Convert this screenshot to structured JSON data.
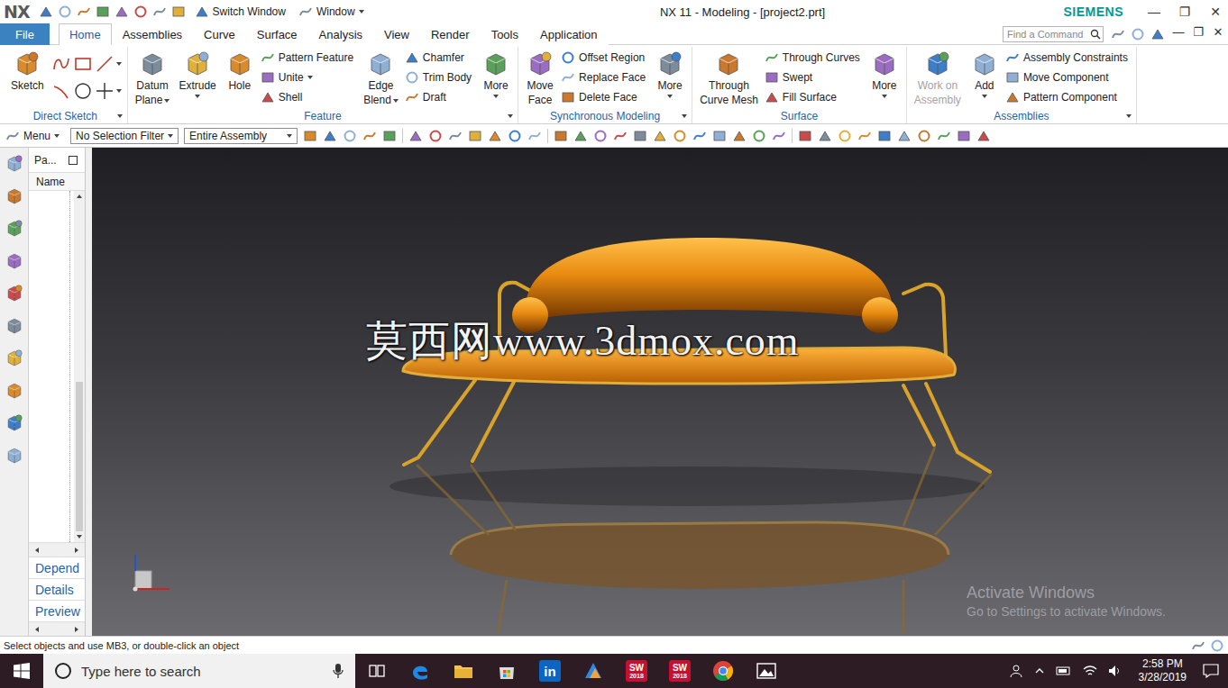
{
  "title_bar": {
    "logo": "NX",
    "switch_window": "Switch Window",
    "window_menu": "Window",
    "title": "NX 11 - Modeling - [project2.prt]",
    "brand": "SIEMENS",
    "controls": [
      "—",
      "❐",
      "✕"
    ]
  },
  "menu_tabs": [
    {
      "label": "File",
      "selected": false,
      "kind": "file"
    },
    {
      "label": "Home",
      "selected": true,
      "kind": "tab"
    },
    {
      "label": "Assemblies",
      "selected": false,
      "kind": "tab"
    },
    {
      "label": "Curve",
      "selected": false,
      "kind": "tab"
    },
    {
      "label": "Surface",
      "selected": false,
      "kind": "tab"
    },
    {
      "label": "Analysis",
      "selected": false,
      "kind": "tab"
    },
    {
      "label": "View",
      "selected": false,
      "kind": "tab"
    },
    {
      "label": "Render",
      "selected": false,
      "kind": "tab"
    },
    {
      "label": "Tools",
      "selected": false,
      "kind": "tab"
    },
    {
      "label": "Application",
      "selected": false,
      "kind": "tab"
    }
  ],
  "command_search": {
    "placeholder": "Find a Command"
  },
  "inner_controls": [
    "—",
    "❐",
    "✕"
  ],
  "ribbon_groups": [
    {
      "title": "Direct Sketch",
      "expandable": true,
      "items": [
        {
          "kind": "large",
          "lines": [
            "Sketch"
          ],
          "dropdown": false,
          "disabled": false
        },
        {
          "kind": "sketch_tools"
        }
      ]
    },
    {
      "title": "Feature",
      "expandable": true,
      "items": [
        {
          "kind": "large",
          "lines": [
            "Datum",
            "Plane"
          ],
          "dropdown": true,
          "disabled": false
        },
        {
          "kind": "large",
          "lines": [
            "Extrude"
          ],
          "dropdown": true,
          "disabled": false
        },
        {
          "kind": "large",
          "lines": [
            "Hole"
          ],
          "dropdown": false,
          "disabled": false
        },
        {
          "kind": "column",
          "items": [
            {
              "label": "Pattern Feature",
              "dropdown": false
            },
            {
              "label": "Unite",
              "dropdown": true
            },
            {
              "label": "Shell",
              "dropdown": false
            }
          ]
        },
        {
          "kind": "large",
          "lines": [
            "Edge",
            "Blend"
          ],
          "dropdown": true,
          "disabled": false
        },
        {
          "kind": "column",
          "items": [
            {
              "label": "Chamfer",
              "dropdown": false
            },
            {
              "label": "Trim Body",
              "dropdown": false
            },
            {
              "label": "Draft",
              "dropdown": false
            }
          ]
        },
        {
          "kind": "large",
          "lines": [
            "More"
          ],
          "dropdown": true,
          "disabled": false
        }
      ]
    },
    {
      "title": "Synchronous Modeling",
      "expandable": true,
      "items": [
        {
          "kind": "large",
          "lines": [
            "Move",
            "Face"
          ],
          "dropdown": false,
          "disabled": false
        },
        {
          "kind": "column",
          "items": [
            {
              "label": "Offset Region",
              "dropdown": false
            },
            {
              "label": "Replace Face",
              "dropdown": false
            },
            {
              "label": "Delete Face",
              "dropdown": false
            }
          ]
        },
        {
          "kind": "large",
          "lines": [
            "More"
          ],
          "dropdown": true,
          "disabled": false
        }
      ]
    },
    {
      "title": "Surface",
      "expandable": false,
      "items": [
        {
          "kind": "large",
          "lines": [
            "Through",
            "Curve Mesh"
          ],
          "dropdown": false,
          "disabled": false
        },
        {
          "kind": "column",
          "items": [
            {
              "label": "Through Curves",
              "dropdown": false
            },
            {
              "label": "Swept",
              "dropdown": false
            },
            {
              "label": "Fill Surface",
              "dropdown": false
            }
          ]
        },
        {
          "kind": "large",
          "lines": [
            "More"
          ],
          "dropdown": true,
          "disabled": false
        }
      ]
    },
    {
      "title": "Assemblies",
      "expandable": true,
      "items": [
        {
          "kind": "large",
          "lines": [
            "Work on",
            "Assembly"
          ],
          "dropdown": false,
          "disabled": true
        },
        {
          "kind": "large",
          "lines": [
            "Add"
          ],
          "dropdown": true,
          "disabled": false
        },
        {
          "kind": "column",
          "items": [
            {
              "label": "Assembly Constraints",
              "dropdown": false
            },
            {
              "label": "Move Component",
              "dropdown": false
            },
            {
              "label": "Pattern Component",
              "dropdown": false
            }
          ]
        }
      ]
    }
  ],
  "selection_bar": {
    "menu": "Menu",
    "filter": "No Selection Filter",
    "scope": "Entire Assembly"
  },
  "navigator": {
    "title": "Pa...",
    "column": "Name",
    "links": [
      "Depend",
      "Details",
      "Preview"
    ]
  },
  "viewport": {
    "watermark": "莫西网www.3dmox.com",
    "activation_title": "Activate Windows",
    "activation_text": "Go to Settings to activate Windows."
  },
  "status_bar": {
    "text": "Select objects and use MB3, or double-click an object"
  },
  "taskbar": {
    "search_placeholder": "Type here to search",
    "apps": [
      {
        "kind": "task_view"
      },
      {
        "kind": "edge"
      },
      {
        "kind": "explorer"
      },
      {
        "kind": "store"
      },
      {
        "kind": "linkedin",
        "text": "in"
      },
      {
        "kind": "app"
      },
      {
        "kind": "solidworks",
        "text": "SW",
        "sub": "2018"
      },
      {
        "kind": "solidworks",
        "text": "SW",
        "sub": "2018"
      },
      {
        "kind": "chrome"
      },
      {
        "kind": "photos"
      }
    ],
    "time": "2:58 PM",
    "date": "3/28/2019"
  }
}
